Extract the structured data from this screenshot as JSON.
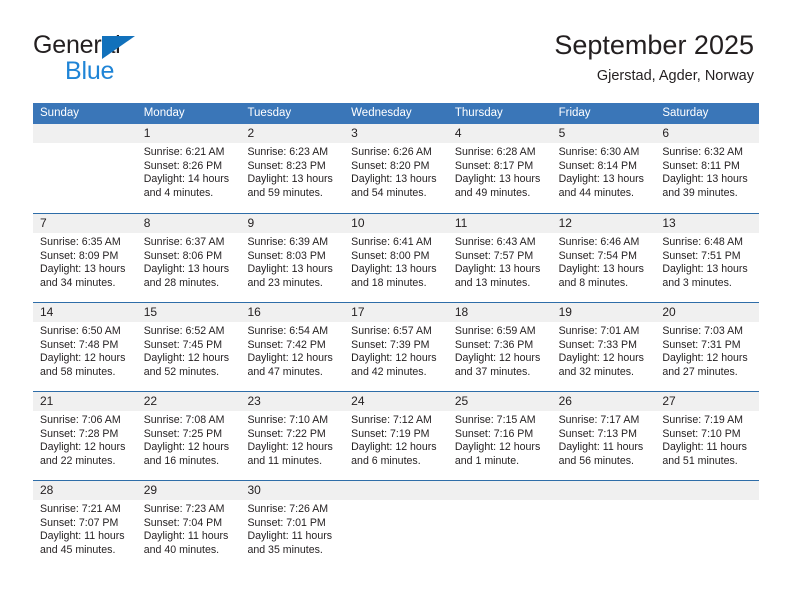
{
  "brand": {
    "word1": "General",
    "word2": "Blue",
    "triangle_color": "#1271bb",
    "blue_color": "#1f84d6"
  },
  "header": {
    "title": "September 2025",
    "subtitle": "Gjerstad, Agder, Norway"
  },
  "theme": {
    "header_blue": "#3a76b8",
    "row_divider_blue": "#2e6da8",
    "day_number_bg": "#f0f0f0",
    "text": "#231f20"
  },
  "weekdays": [
    "Sunday",
    "Monday",
    "Tuesday",
    "Wednesday",
    "Thursday",
    "Friday",
    "Saturday"
  ],
  "weeks": [
    [
      {
        "day": ""
      },
      {
        "day": "1",
        "sunrise": "Sunrise: 6:21 AM",
        "sunset": "Sunset: 8:26 PM",
        "daylight1": "Daylight: 14 hours",
        "daylight2": "and 4 minutes."
      },
      {
        "day": "2",
        "sunrise": "Sunrise: 6:23 AM",
        "sunset": "Sunset: 8:23 PM",
        "daylight1": "Daylight: 13 hours",
        "daylight2": "and 59 minutes."
      },
      {
        "day": "3",
        "sunrise": "Sunrise: 6:26 AM",
        "sunset": "Sunset: 8:20 PM",
        "daylight1": "Daylight: 13 hours",
        "daylight2": "and 54 minutes."
      },
      {
        "day": "4",
        "sunrise": "Sunrise: 6:28 AM",
        "sunset": "Sunset: 8:17 PM",
        "daylight1": "Daylight: 13 hours",
        "daylight2": "and 49 minutes."
      },
      {
        "day": "5",
        "sunrise": "Sunrise: 6:30 AM",
        "sunset": "Sunset: 8:14 PM",
        "daylight1": "Daylight: 13 hours",
        "daylight2": "and 44 minutes."
      },
      {
        "day": "6",
        "sunrise": "Sunrise: 6:32 AM",
        "sunset": "Sunset: 8:11 PM",
        "daylight1": "Daylight: 13 hours",
        "daylight2": "and 39 minutes."
      }
    ],
    [
      {
        "day": "7",
        "sunrise": "Sunrise: 6:35 AM",
        "sunset": "Sunset: 8:09 PM",
        "daylight1": "Daylight: 13 hours",
        "daylight2": "and 34 minutes."
      },
      {
        "day": "8",
        "sunrise": "Sunrise: 6:37 AM",
        "sunset": "Sunset: 8:06 PM",
        "daylight1": "Daylight: 13 hours",
        "daylight2": "and 28 minutes."
      },
      {
        "day": "9",
        "sunrise": "Sunrise: 6:39 AM",
        "sunset": "Sunset: 8:03 PM",
        "daylight1": "Daylight: 13 hours",
        "daylight2": "and 23 minutes."
      },
      {
        "day": "10",
        "sunrise": "Sunrise: 6:41 AM",
        "sunset": "Sunset: 8:00 PM",
        "daylight1": "Daylight: 13 hours",
        "daylight2": "and 18 minutes."
      },
      {
        "day": "11",
        "sunrise": "Sunrise: 6:43 AM",
        "sunset": "Sunset: 7:57 PM",
        "daylight1": "Daylight: 13 hours",
        "daylight2": "and 13 minutes."
      },
      {
        "day": "12",
        "sunrise": "Sunrise: 6:46 AM",
        "sunset": "Sunset: 7:54 PM",
        "daylight1": "Daylight: 13 hours",
        "daylight2": "and 8 minutes."
      },
      {
        "day": "13",
        "sunrise": "Sunrise: 6:48 AM",
        "sunset": "Sunset: 7:51 PM",
        "daylight1": "Daylight: 13 hours",
        "daylight2": "and 3 minutes."
      }
    ],
    [
      {
        "day": "14",
        "sunrise": "Sunrise: 6:50 AM",
        "sunset": "Sunset: 7:48 PM",
        "daylight1": "Daylight: 12 hours",
        "daylight2": "and 58 minutes."
      },
      {
        "day": "15",
        "sunrise": "Sunrise: 6:52 AM",
        "sunset": "Sunset: 7:45 PM",
        "daylight1": "Daylight: 12 hours",
        "daylight2": "and 52 minutes."
      },
      {
        "day": "16",
        "sunrise": "Sunrise: 6:54 AM",
        "sunset": "Sunset: 7:42 PM",
        "daylight1": "Daylight: 12 hours",
        "daylight2": "and 47 minutes."
      },
      {
        "day": "17",
        "sunrise": "Sunrise: 6:57 AM",
        "sunset": "Sunset: 7:39 PM",
        "daylight1": "Daylight: 12 hours",
        "daylight2": "and 42 minutes."
      },
      {
        "day": "18",
        "sunrise": "Sunrise: 6:59 AM",
        "sunset": "Sunset: 7:36 PM",
        "daylight1": "Daylight: 12 hours",
        "daylight2": "and 37 minutes."
      },
      {
        "day": "19",
        "sunrise": "Sunrise: 7:01 AM",
        "sunset": "Sunset: 7:33 PM",
        "daylight1": "Daylight: 12 hours",
        "daylight2": "and 32 minutes."
      },
      {
        "day": "20",
        "sunrise": "Sunrise: 7:03 AM",
        "sunset": "Sunset: 7:31 PM",
        "daylight1": "Daylight: 12 hours",
        "daylight2": "and 27 minutes."
      }
    ],
    [
      {
        "day": "21",
        "sunrise": "Sunrise: 7:06 AM",
        "sunset": "Sunset: 7:28 PM",
        "daylight1": "Daylight: 12 hours",
        "daylight2": "and 22 minutes."
      },
      {
        "day": "22",
        "sunrise": "Sunrise: 7:08 AM",
        "sunset": "Sunset: 7:25 PM",
        "daylight1": "Daylight: 12 hours",
        "daylight2": "and 16 minutes."
      },
      {
        "day": "23",
        "sunrise": "Sunrise: 7:10 AM",
        "sunset": "Sunset: 7:22 PM",
        "daylight1": "Daylight: 12 hours",
        "daylight2": "and 11 minutes."
      },
      {
        "day": "24",
        "sunrise": "Sunrise: 7:12 AM",
        "sunset": "Sunset: 7:19 PM",
        "daylight1": "Daylight: 12 hours",
        "daylight2": "and 6 minutes."
      },
      {
        "day": "25",
        "sunrise": "Sunrise: 7:15 AM",
        "sunset": "Sunset: 7:16 PM",
        "daylight1": "Daylight: 12 hours",
        "daylight2": "and 1 minute."
      },
      {
        "day": "26",
        "sunrise": "Sunrise: 7:17 AM",
        "sunset": "Sunset: 7:13 PM",
        "daylight1": "Daylight: 11 hours",
        "daylight2": "and 56 minutes."
      },
      {
        "day": "27",
        "sunrise": "Sunrise: 7:19 AM",
        "sunset": "Sunset: 7:10 PM",
        "daylight1": "Daylight: 11 hours",
        "daylight2": "and 51 minutes."
      }
    ],
    [
      {
        "day": "28",
        "sunrise": "Sunrise: 7:21 AM",
        "sunset": "Sunset: 7:07 PM",
        "daylight1": "Daylight: 11 hours",
        "daylight2": "and 45 minutes."
      },
      {
        "day": "29",
        "sunrise": "Sunrise: 7:23 AM",
        "sunset": "Sunset: 7:04 PM",
        "daylight1": "Daylight: 11 hours",
        "daylight2": "and 40 minutes."
      },
      {
        "day": "30",
        "sunrise": "Sunrise: 7:26 AM",
        "sunset": "Sunset: 7:01 PM",
        "daylight1": "Daylight: 11 hours",
        "daylight2": "and 35 minutes."
      },
      {
        "day": ""
      },
      {
        "day": ""
      },
      {
        "day": ""
      },
      {
        "day": ""
      }
    ]
  ]
}
